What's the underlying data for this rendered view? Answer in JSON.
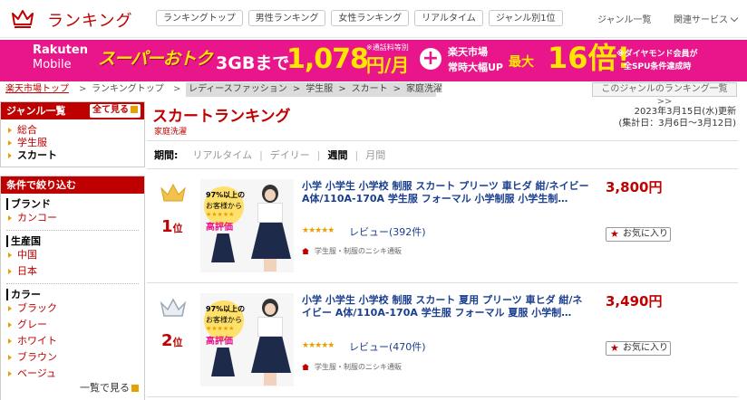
{
  "header": {
    "logo_text": "ランキング",
    "nav": [
      "ランキングトップ",
      "男性ランキング",
      "女性ランキング",
      "リアルタイム",
      "ジャンル別1位"
    ],
    "genre_list": "ジャンル一覧",
    "related": "関連サービス"
  },
  "banner": {
    "brand1": "Rakuten",
    "brand2": "Mobile",
    "super": "スーパーおトク",
    "gb": "3GBまで",
    "note": "※通話料等別",
    "price": "1,078",
    "yen": "円/月",
    "plus": "+",
    "rt1": "楽天市場",
    "rt2": "常時大幅UP",
    "max": "最大",
    "times": "16倍!",
    "dia1": "※ダイヤモンド会員が",
    "dia2": "全SPU条件達成時"
  },
  "breadcrumb": {
    "top": "楽天市場トップ",
    "sep": ">",
    "ranking": "ランキングトップ",
    "gray": [
      "レディースファッション",
      ">",
      "学生服",
      ">",
      "スカート",
      ">",
      "家庭洗濯"
    ],
    "right": "このジャンルのランキング一覧 >>"
  },
  "sidebar": {
    "genre_head": "ジャンル一覧",
    "see_all": "全て見る",
    "genres": [
      "総合",
      "学生服",
      "スカート"
    ],
    "filter_head": "条件で絞り込む",
    "groups": [
      {
        "title": "ブランド",
        "items": [
          "カンコー"
        ]
      },
      {
        "title": "生産国",
        "items": [
          "中国",
          "日本"
        ]
      },
      {
        "title": "カラー",
        "items": [
          "ブラック",
          "グレー",
          "ホワイト",
          "ブラウン",
          "ベージュ"
        ]
      }
    ],
    "more": "一覧で見る"
  },
  "main": {
    "title": "スカートランキング",
    "subtitle": "家庭洗濯",
    "updated1": "2023年3月15日(水)更新",
    "updated2": "(集計日：3月6日～3月12日)",
    "period_label": "期間:",
    "periods": [
      "リアルタイム",
      "デイリー",
      "週間",
      "月間"
    ],
    "current_period": "週間"
  },
  "thumb_text": {
    "b1": "97%以上の",
    "b2": "お客様から",
    "b3": "★★★★★",
    "b4": "高評価"
  },
  "items": [
    {
      "rank": "1",
      "rank_suffix": "位",
      "title": "小学 小学生 小学校 制服 スカート プリーツ 車ヒダ 紺/ネイビー A体/110A-170A 学生服 フォーマル 小学制服 小学生制…",
      "stars": "★★★★★",
      "review": "レビュー(392件)",
      "shop": "学生服・制服のニシキ通販",
      "price": "3,800円",
      "fav": "お気に入り"
    },
    {
      "rank": "2",
      "rank_suffix": "位",
      "title": "小学 小学生 小学校 制服 スカート 夏用 プリーツ 車ヒダ 紺/ネイビー A体/110A-170A 学生服 フォーマル 夏服 小学制…",
      "stars": "★★★★★",
      "review": "レビュー(470件)",
      "shop": "学生服・制服のニシキ通販",
      "price": "3,490円",
      "fav": "お気に入り"
    }
  ],
  "colors": {
    "accent": "#bf0000",
    "banner": "#e8168a",
    "gold": "#e8a000",
    "link": "#1a3f8f"
  }
}
